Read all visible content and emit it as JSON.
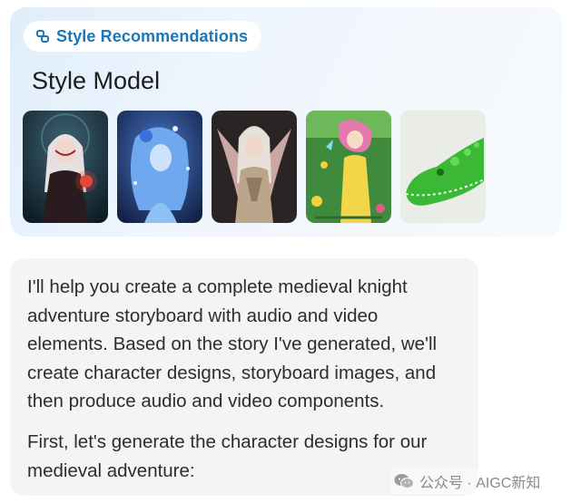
{
  "style_section": {
    "pill_label": "Style Recommendations",
    "title": "Style Model",
    "thumbnails": [
      {
        "name": "gothic-girl"
      },
      {
        "name": "blue-fairy"
      },
      {
        "name": "angel-wings"
      },
      {
        "name": "anime-garden-girl"
      },
      {
        "name": "green-crocodile"
      }
    ]
  },
  "message": {
    "paragraph_1": "I'll help you create a complete medieval knight adventure storyboard with audio and video elements. Based on the story I've generated, we'll create character designs, storyboard images, and then produce audio and video components.",
    "paragraph_2": "First, let's generate the character designs for our medieval adventure:"
  },
  "watermark": {
    "text": "公众号 · AIGC新知",
    "icon": "wechat-icon"
  },
  "colors": {
    "accent": "#1a77b8",
    "card_bg": "#eaf3fc",
    "bubble_bg": "#f4f4f5"
  }
}
